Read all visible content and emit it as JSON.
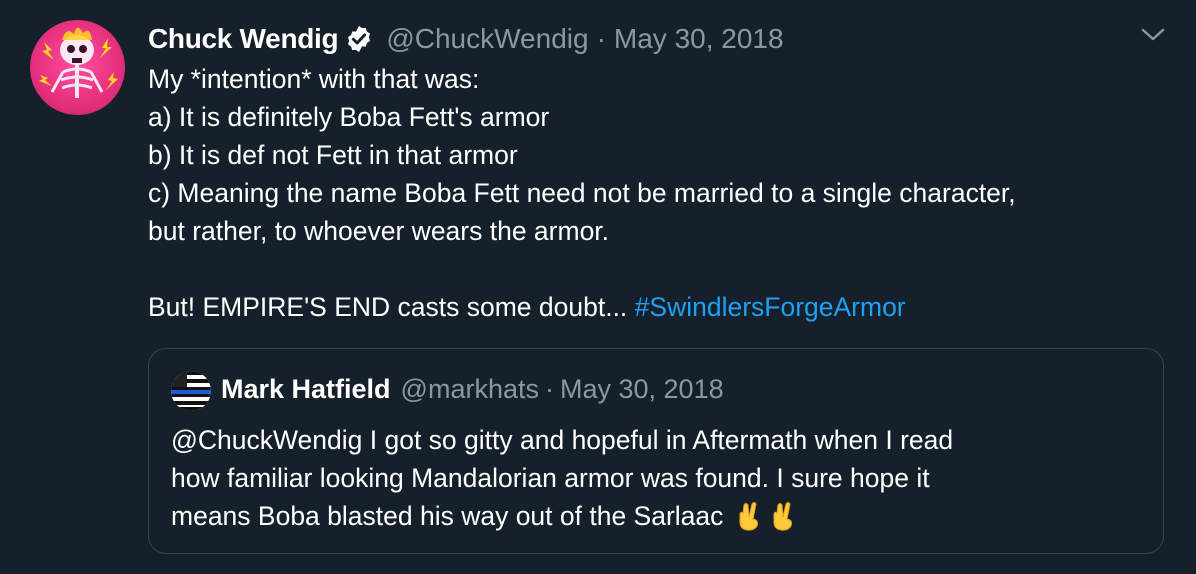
{
  "tweet": {
    "author": {
      "display_name": "Chuck Wendig",
      "verified": true,
      "handle": "@ChuckWendig"
    },
    "separator": "·",
    "date": "May 30, 2018",
    "lines": [
      "My *intention* with that was:",
      "a) It is definitely Boba Fett's armor",
      "b) It is def not Fett in that armor",
      "c) Meaning the name Boba Fett need not be married to a single character,",
      "but rather, to whoever wears the armor."
    ],
    "last_line_text": "But! EMPIRE'S END casts some doubt... ",
    "hashtag": "#SwindlersForgeArmor",
    "menu_icon": "chevron-down-icon"
  },
  "quote": {
    "author": {
      "display_name": "Mark Hatfield",
      "handle": "@markhats"
    },
    "separator": "·",
    "date": "May 30, 2018",
    "lines": [
      "@ChuckWendig I got so gitty and hopeful in Aftermath when I read",
      "how familiar looking Mandalorian armor was found. I sure hope it",
      "means Boba blasted his way out of the Sarlaac"
    ],
    "emoji": [
      "crossed-fingers-emoji",
      "crossed-fingers-emoji"
    ]
  },
  "colors": {
    "background": "#15202b",
    "text": "#ffffff",
    "secondary": "#8899a6",
    "link": "#1da1f2",
    "border": "#38444d"
  }
}
